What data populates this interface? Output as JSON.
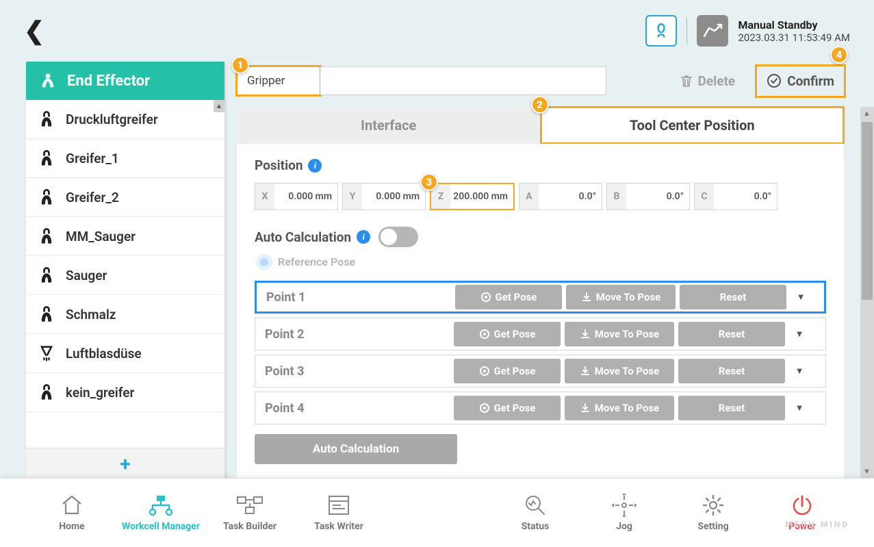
{
  "topbar": {
    "status_title": "Manual Standby",
    "status_time": "2023.03.31 11:53:49 AM"
  },
  "sidebar": {
    "header": "End Effector",
    "items": [
      {
        "label": "Druckluftgreifer",
        "icon": "gripper"
      },
      {
        "label": "Greifer_1",
        "icon": "gripper"
      },
      {
        "label": "Greifer_2",
        "icon": "gripper"
      },
      {
        "label": "MM_Sauger",
        "icon": "gripper"
      },
      {
        "label": "Sauger",
        "icon": "gripper"
      },
      {
        "label": "Schmalz",
        "icon": "gripper"
      },
      {
        "label": "Luftblasdüse",
        "icon": "nozzle"
      },
      {
        "label": "kein_greifer",
        "icon": "gripper"
      }
    ]
  },
  "main": {
    "name_value": "Gripper",
    "delete_label": "Delete",
    "confirm_label": "Confirm",
    "tabs": {
      "interface": "Interface",
      "tcp": "Tool Center Position"
    },
    "position_label": "Position",
    "coords": {
      "X": "0.000 mm",
      "Y": "0.000 mm",
      "Z": "200.000 mm",
      "A": "0.0°",
      "B": "0.0°",
      "C": "0.0°"
    },
    "auto_calc_label": "Auto Calculation",
    "reference_label": "Reference Pose",
    "points": [
      "Point 1",
      "Point 2",
      "Point 3",
      "Point 4"
    ],
    "btn_get_pose": "Get Pose",
    "btn_move_to": "Move To Pose",
    "btn_reset": "Reset",
    "btn_auto_calc": "Auto Calculation"
  },
  "annotations": {
    "m1": "1",
    "m2": "2",
    "m3": "3",
    "m4": "4"
  },
  "bottom": {
    "home": "Home",
    "workcell": "Workcell Manager",
    "task_builder": "Task Builder",
    "task_writer": "Task Writer",
    "status": "Status",
    "jog": "Jog",
    "setting": "Setting",
    "power": "Power"
  },
  "watermark": "MECH MIND"
}
